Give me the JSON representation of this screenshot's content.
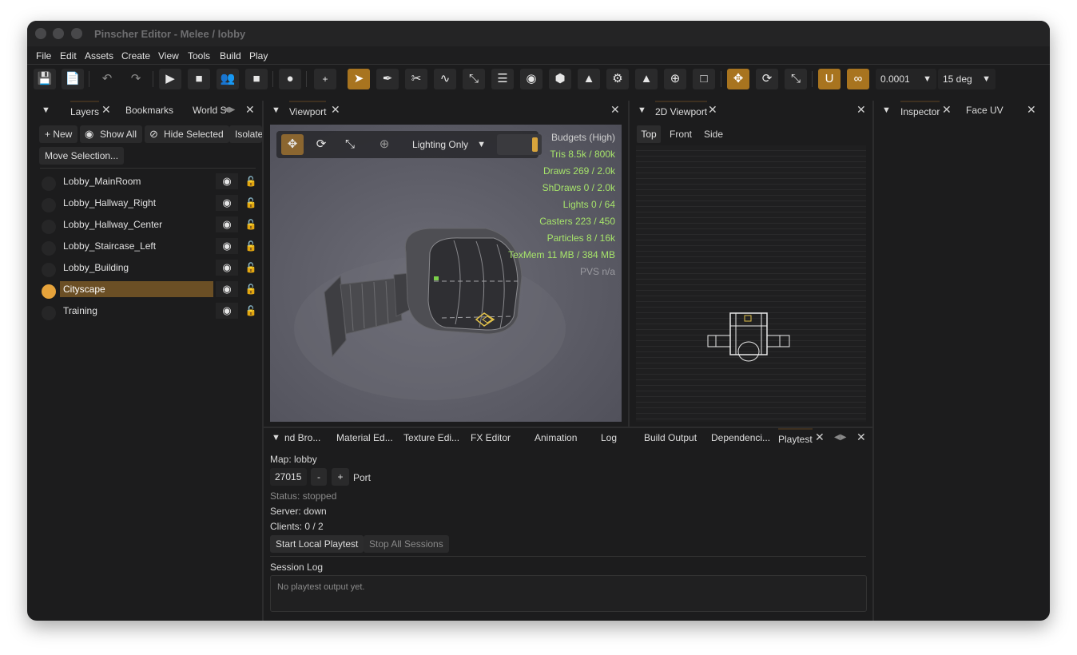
{
  "window": {
    "title": "Pinscher Editor - Melee / lobby"
  },
  "menu": [
    "File",
    "Edit",
    "Assets",
    "Create",
    "View",
    "Tools",
    "Build",
    "Play"
  ],
  "toolbar": {
    "snap_value": "0.0001",
    "angle_value": "15 deg",
    "plus_label": "+",
    "buttons": [
      "save-icon",
      "save-as-icon",
      "undo-icon",
      "redo-icon",
      "play-icon",
      "stop-icon",
      "players-icon",
      "stop-square-icon",
      "bulb-icon",
      "select-icon",
      "brush-icon",
      "scissors-icon",
      "path-icon",
      "scale-icon",
      "ruler-icon",
      "eye-icon",
      "cube-icon",
      "stamp-icon",
      "gear-icon",
      "triangle-icon",
      "target-icon",
      "crop-icon",
      "move-icon",
      "rotate-icon",
      "resize-icon",
      "magnet-icon",
      "link-icon"
    ]
  },
  "left_panel": {
    "tabs": [
      "Layers",
      "Bookmarks",
      "World S"
    ],
    "buttons": {
      "new": "+ New",
      "show_all": "Show All",
      "hide_selected": "Hide Selected",
      "isolate": "Isolate",
      "move_selection": "Move Selection..."
    },
    "layers": [
      {
        "name": "Lobby_MainRoom",
        "active": false
      },
      {
        "name": "Lobby_Hallway_Right",
        "active": false
      },
      {
        "name": "Lobby_Hallway_Center",
        "active": false
      },
      {
        "name": "Lobby_Staircase_Left",
        "active": false
      },
      {
        "name": "Lobby_Building",
        "active": false
      },
      {
        "name": "Cityscape",
        "active": true
      },
      {
        "name": "Training",
        "active": false
      }
    ]
  },
  "viewport": {
    "tab": "Viewport",
    "render_mode": "Lighting Only",
    "budgets": {
      "header": "Budgets (High)",
      "tris": "Tris  8.5k / 800k",
      "draws": "Draws  269 / 2.0k",
      "shdraws": "ShDraws  0 / 2.0k",
      "lights": "Lights  0 / 64",
      "casters": "Casters  223 / 450",
      "particles": "Particles  8 / 16k",
      "texmem": "TexMem  11 MB / 384 MB",
      "pvs": "PVS  n/a"
    }
  },
  "viewport2d": {
    "tab": "2D Viewport",
    "views": [
      "Top",
      "Front",
      "Side"
    ]
  },
  "inspector": {
    "tabs": [
      "Inspector",
      "Face UV"
    ]
  },
  "bottom_panel": {
    "tabs": [
      "nd Bro...",
      "Material Ed...",
      "Texture Edi...",
      "FX Editor",
      "Animation",
      "Log",
      "Build Output",
      "Dependenci...",
      "Playtest"
    ],
    "map": "Map: lobby",
    "port_value": "27015",
    "minus": "-",
    "plus": "+",
    "port_label": "Port",
    "status": "Status: stopped",
    "server": "Server: down",
    "clients": "Clients: 0 / 2",
    "start_button": "Start Local Playtest",
    "stop_button": "Stop All Sessions",
    "session_log_label": "Session Log",
    "session_log_text": "No playtest output yet."
  }
}
